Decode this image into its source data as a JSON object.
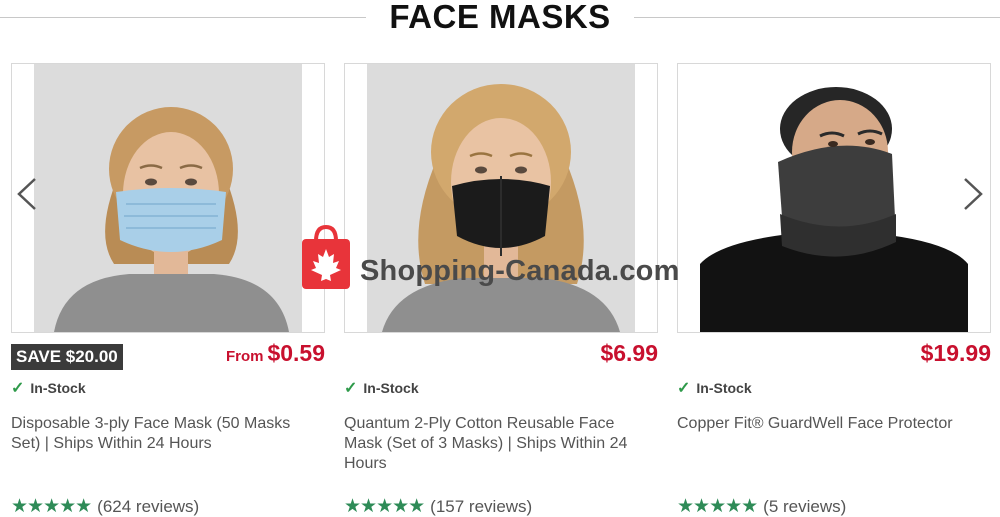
{
  "section": {
    "title": "FACE MASKS"
  },
  "carousel": {
    "prev_icon": "chevron-left-icon",
    "next_icon": "chevron-right-icon"
  },
  "products": [
    {
      "badge": "SAVE $20.00",
      "price_prefix": "From",
      "price": "$0.59",
      "stock": "In-Stock",
      "title": "Disposable 3-ply Face Mask (50 Masks Set) | Ships Within 24 Hours",
      "stars": "★★★★★",
      "reviews": "(624 reviews)",
      "rating": 5
    },
    {
      "badge": "",
      "price_prefix": "",
      "price": "$6.99",
      "stock": "In-Stock",
      "title": "Quantum 2-Ply Cotton Reusable Face Mask (Set of 3 Masks) | Ships Within 24 Hours",
      "stars": "★★★★★",
      "reviews": "(157 reviews)",
      "rating": 5
    },
    {
      "badge": "",
      "price_prefix": "",
      "price": "$19.99",
      "stock": "In-Stock",
      "title": "Copper Fit® GuardWell Face Protector",
      "stars": "★★★★★",
      "reviews": "(5 reviews)",
      "rating": 5
    }
  ],
  "watermark": {
    "text": "Shopping-Canada.com"
  },
  "colors": {
    "price": "#c8102e",
    "stars": "#2e8b57",
    "badge_bg": "#3b3b3b",
    "watermark_red": "#e8343a"
  }
}
